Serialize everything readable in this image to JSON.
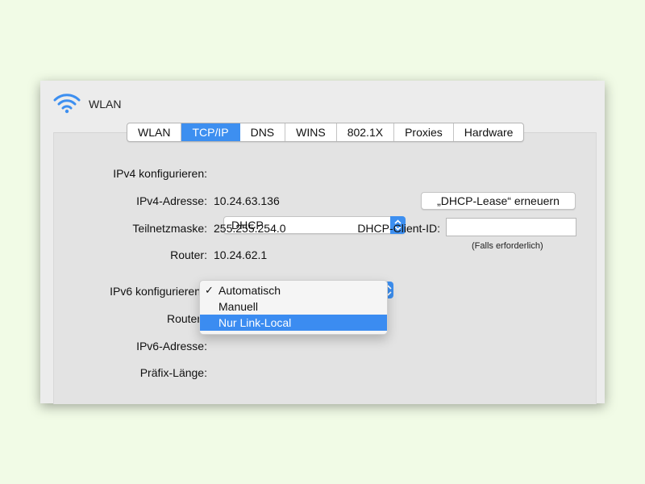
{
  "window": {
    "title": "WLAN",
    "icon": "wifi-icon"
  },
  "tabs": [
    {
      "label": "WLAN",
      "active": false
    },
    {
      "label": "TCP/IP",
      "active": true
    },
    {
      "label": "DNS",
      "active": false
    },
    {
      "label": "WINS",
      "active": false
    },
    {
      "label": "802.1X",
      "active": false
    },
    {
      "label": "Proxies",
      "active": false
    },
    {
      "label": "Hardware",
      "active": false
    }
  ],
  "ipv4": {
    "configure_label": "IPv4 konfigurieren:",
    "configure_value": "DHCP",
    "address_label": "IPv4-Adresse:",
    "address_value": "10.24.63.136",
    "subnet_label": "Teilnetzmaske:",
    "subnet_value": "255.255.254.0",
    "router_label": "Router:",
    "router_value": "10.24.62.1"
  },
  "dhcp": {
    "renew_button": "„DHCP-Lease“ erneuern",
    "client_id_label": "DHCP-Client-ID:",
    "client_id_value": "",
    "client_id_hint": "(Falls erforderlich)"
  },
  "ipv6": {
    "configure_label": "IPv6 konfigurieren",
    "router_label": "Router",
    "address_label": "IPv6-Adresse:",
    "prefix_label": "Präfix-Länge:"
  },
  "ipv6_menu": {
    "items": [
      {
        "label": "Automatisch",
        "checked": true,
        "highlighted": false
      },
      {
        "label": "Manuell",
        "checked": false,
        "highlighted": false
      },
      {
        "label": "Nur Link-Local",
        "checked": false,
        "highlighted": true
      }
    ],
    "check_glyph": "✓"
  },
  "colors": {
    "accent": "#3d8ff0",
    "background": "#f1fbe6",
    "window": "#ececec"
  }
}
